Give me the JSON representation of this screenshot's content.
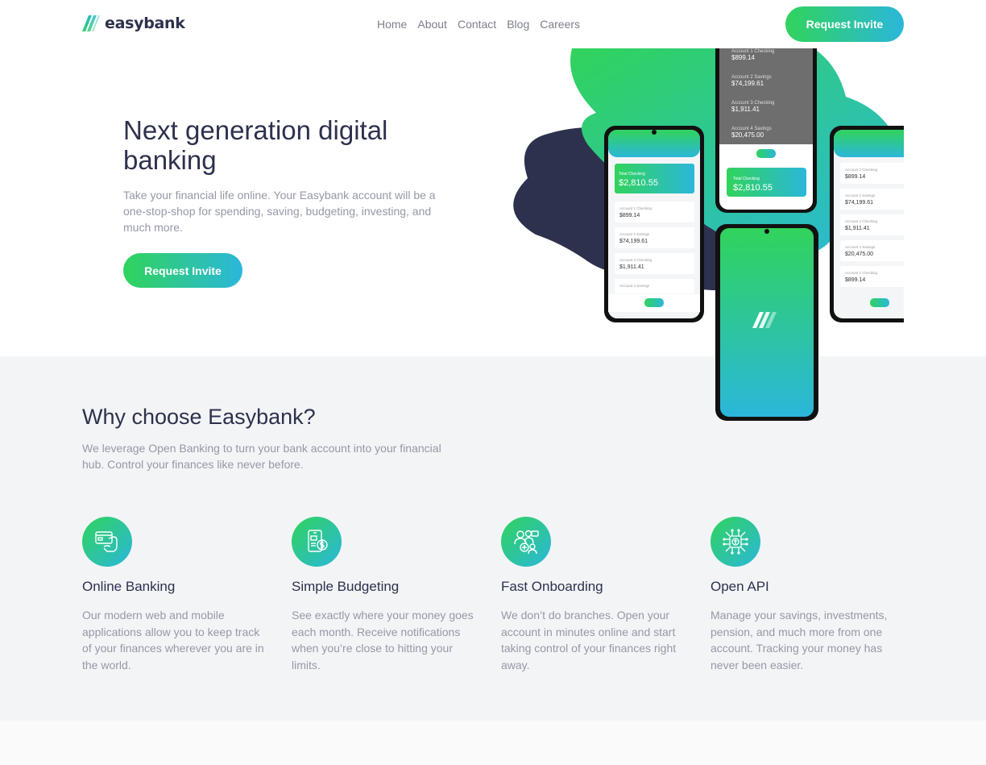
{
  "header": {
    "logo_text": "easybank",
    "nav": [
      "Home",
      "About",
      "Contact",
      "Blog",
      "Careers"
    ],
    "cta": "Request Invite"
  },
  "hero": {
    "title": "Next generation digital banking",
    "description": "Take your financial life online. Your Easybank account will be a one-stop-shop for spending, saving, budgeting, investing, and much more.",
    "cta": "Request Invite",
    "phones": {
      "total_label": "Total Checking",
      "total": "$2,810.55",
      "accounts": [
        {
          "label": "Account 1 Checking",
          "amount": "$899.14"
        },
        {
          "label": "Account 2 Savings",
          "amount": "$74,199.61"
        },
        {
          "label": "Account 3 Checking",
          "amount": "$1,911.41"
        },
        {
          "label": "Account 4 Savings",
          "amount": "$20,475.00"
        }
      ]
    }
  },
  "features": {
    "title": "Why choose Easybank?",
    "description": "We leverage Open Banking to turn your bank account into your financial hub. Control your finances like never before.",
    "items": [
      {
        "icon": "online-banking-icon",
        "title": "Online Banking",
        "description": "Our modern web and mobile applications allow you to keep track of your finances wherever you are in the world."
      },
      {
        "icon": "budgeting-icon",
        "title": "Simple Budgeting",
        "description": "See exactly where your money goes each month. Receive notifications when you’re close to hitting your limits."
      },
      {
        "icon": "onboarding-icon",
        "title": "Fast Onboarding",
        "description": "We don’t do branches. Open your account in minutes online and start taking control of your finances right away."
      },
      {
        "icon": "api-icon",
        "title": "Open API",
        "description": "Manage your savings, investments, pension, and much more from one account. Tracking your money has never been easier."
      }
    ]
  },
  "colors": {
    "dark_blue": "#2d314d",
    "lime_green": "#31d35c",
    "bright_cyan": "#2bb7da",
    "grayish_blue": "#9698a6",
    "light_gray": "#f3f4f6"
  }
}
